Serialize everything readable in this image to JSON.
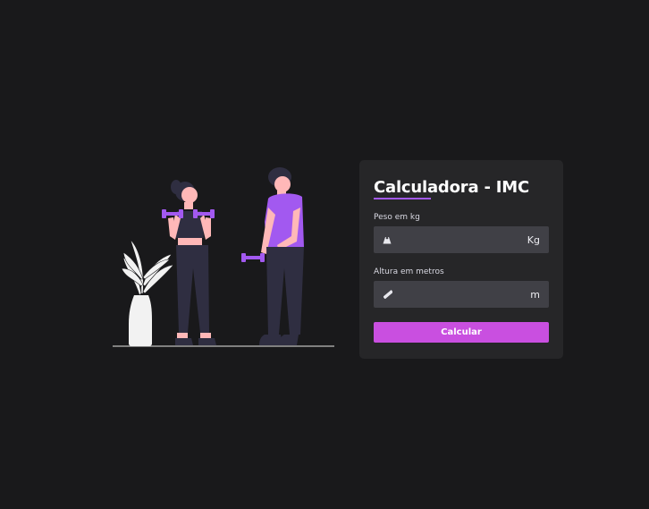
{
  "card": {
    "title": "Calculadora - IMC",
    "weight": {
      "label": "Peso em kg",
      "value": "",
      "placeholder": "",
      "unit": "Kg",
      "icon": "weight-icon"
    },
    "height": {
      "label": "Altura em metros",
      "value": "",
      "placeholder": "",
      "unit": "m",
      "icon": "ruler-icon"
    },
    "submit_label": "Calcular"
  },
  "colors": {
    "background": "#19191b",
    "card": "#262628",
    "input": "#404046",
    "accent_purple": "#a259f0",
    "button": "#c94fe0"
  }
}
